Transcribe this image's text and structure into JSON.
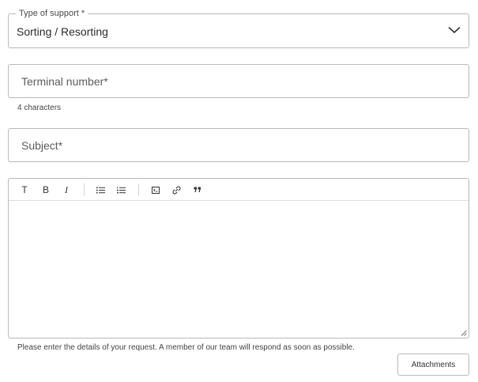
{
  "support_type": {
    "label": "Type of support",
    "required_marker": "*",
    "selected_value": "Sorting / Resorting",
    "icon": "chevron-down-icon"
  },
  "terminal": {
    "placeholder": "Terminal number*",
    "value": "",
    "hint": "4 characters"
  },
  "subject": {
    "placeholder": "Subject*",
    "value": ""
  },
  "editor": {
    "toolbar": [
      {
        "name": "text-style-icon",
        "glyph": "T"
      },
      {
        "name": "bold-icon",
        "glyph": "B"
      },
      {
        "name": "italic-icon",
        "glyph": "I"
      },
      {
        "name": "bullet-list-icon",
        "glyph": ""
      },
      {
        "name": "numbered-list-icon",
        "glyph": ""
      },
      {
        "name": "code-block-icon",
        "glyph": ""
      },
      {
        "name": "link-icon",
        "glyph": ""
      },
      {
        "name": "quote-icon",
        "glyph": ""
      }
    ],
    "content": "",
    "helper_text": "Please enter the details of your request. A member of our team will respond as soon as possible."
  },
  "attachments": {
    "label": "Attachments"
  },
  "colors": {
    "border": "#b9b9b9",
    "text": "#2b2b2b",
    "muted": "#444444"
  }
}
